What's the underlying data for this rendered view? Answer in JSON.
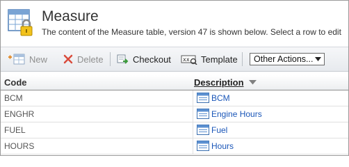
{
  "header": {
    "title": "Measure",
    "subtitle": "The content of the Measure table, version 47 is shown below. Select a row to edit"
  },
  "toolbar": {
    "new_label": "New",
    "delete_label": "Delete",
    "checkout_label": "Checkout",
    "template_label": "Template",
    "actions_selected": "Other Actions..."
  },
  "grid": {
    "columns": {
      "code": "Code",
      "description": "Description"
    },
    "rows": [
      {
        "code": "BCM",
        "description": "BCM"
      },
      {
        "code": "ENGHR",
        "description": "Engine Hours"
      },
      {
        "code": "FUEL",
        "description": "Fuel"
      },
      {
        "code": "HOURS",
        "description": "Hours"
      }
    ]
  }
}
